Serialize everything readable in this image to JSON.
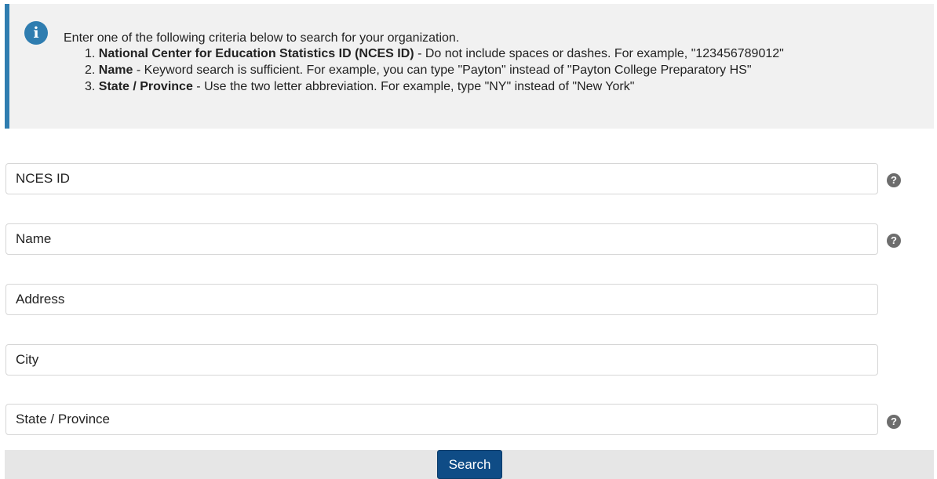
{
  "info": {
    "icon": "info-icon",
    "icon_glyph": "i",
    "intro": "Enter one of the following criteria below to search for your organization.",
    "criteria": [
      {
        "num": "1.",
        "bold": "National Center for Education Statistics ID (NCES ID)",
        "rest": " - Do not include spaces or dashes. For example, \"123456789012\""
      },
      {
        "num": "2.",
        "bold": "Name",
        "rest": " - Keyword search is sufficient. For example, you can type \"Payton\" instead of \"Payton College Preparatory HS\""
      },
      {
        "num": "3.",
        "bold": "State / Province",
        "rest": " - Use the two letter abbreviation. For example, type \"NY\" instead of \"New York\""
      }
    ],
    "accent_color": "#2f7db0"
  },
  "form": {
    "nces_id": {
      "placeholder": "NCES ID",
      "value": ""
    },
    "name": {
      "placeholder": "Name",
      "value": ""
    },
    "address": {
      "placeholder": "Address",
      "value": ""
    },
    "city": {
      "placeholder": "City",
      "value": ""
    },
    "state": {
      "placeholder": "State / Province",
      "value": ""
    },
    "help_glyph": "?",
    "help_icon": "question-circle-icon"
  },
  "search_button": {
    "label": "Search",
    "color": "#0f4c86"
  }
}
